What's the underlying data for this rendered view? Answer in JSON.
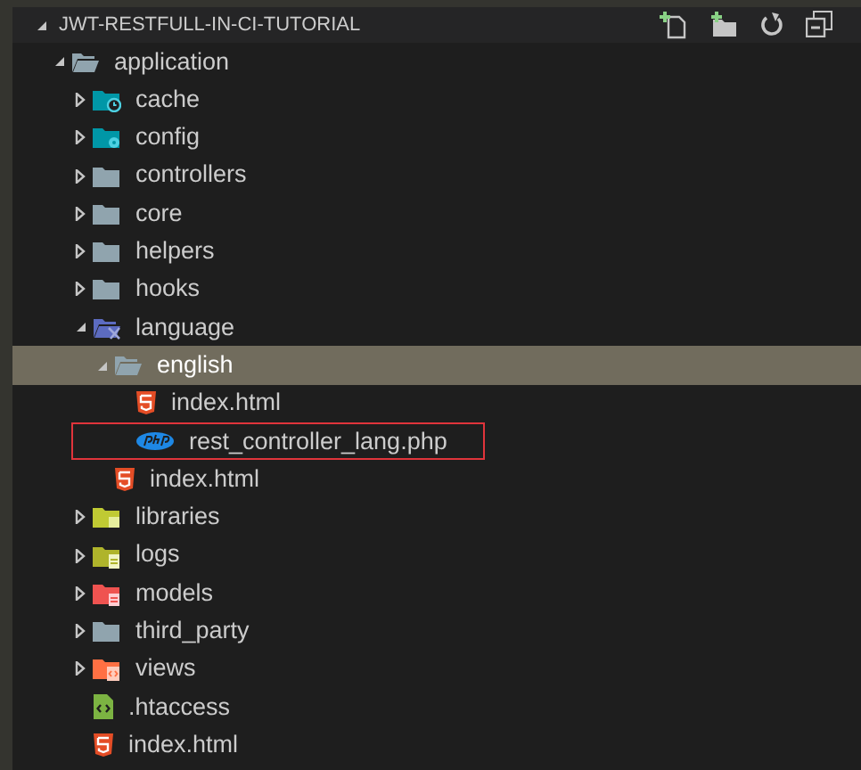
{
  "explorer": {
    "title": "JWT-RESTFULL-IN-CI-TUTORIAL",
    "expanded": true,
    "tree": [
      {
        "name": "application",
        "kind": "folder",
        "expanded": true,
        "selected": false,
        "focused": false,
        "children": [
          {
            "name": "cache",
            "kind": "cachefolder",
            "expanded": false,
            "selected": false,
            "focused": false
          },
          {
            "name": "config",
            "kind": "configfolder",
            "expanded": false,
            "selected": false,
            "focused": false
          },
          {
            "name": "controllers",
            "kind": "folder",
            "expanded": false,
            "selected": false,
            "focused": false
          },
          {
            "name": "core",
            "kind": "folder",
            "expanded": false,
            "selected": false,
            "focused": false
          },
          {
            "name": "helpers",
            "kind": "folder",
            "expanded": false,
            "selected": false,
            "focused": false
          },
          {
            "name": "hooks",
            "kind": "folder",
            "expanded": false,
            "selected": false,
            "focused": false
          },
          {
            "name": "language",
            "kind": "languagefolder",
            "expanded": true,
            "selected": false,
            "focused": false,
            "children": [
              {
                "name": "english",
                "kind": "folder",
                "expanded": true,
                "selected": true,
                "focused": false,
                "children": [
                  {
                    "name": "index.html",
                    "kind": "html",
                    "selected": false,
                    "focused": false
                  },
                  {
                    "name": "rest_controller_lang.php",
                    "kind": "php",
                    "selected": false,
                    "focused": true
                  }
                ]
              },
              {
                "name": "index.html",
                "kind": "html",
                "selected": false,
                "focused": false
              }
            ]
          },
          {
            "name": "libraries",
            "kind": "libraryfolder",
            "expanded": false,
            "selected": false,
            "focused": false
          },
          {
            "name": "logs",
            "kind": "logfolder",
            "expanded": false,
            "selected": false,
            "focused": false
          },
          {
            "name": "models",
            "kind": "modelfolder",
            "expanded": false,
            "selected": false,
            "focused": false
          },
          {
            "name": "third_party",
            "kind": "folder",
            "expanded": false,
            "selected": false,
            "focused": false
          },
          {
            "name": "views",
            "kind": "viewfolder",
            "expanded": false,
            "selected": false,
            "focused": false
          },
          {
            "name": ".htaccess",
            "kind": "htaccess",
            "selected": false,
            "focused": false
          },
          {
            "name": "index.html",
            "kind": "html",
            "selected": false,
            "focused": false
          }
        ]
      }
    ]
  }
}
